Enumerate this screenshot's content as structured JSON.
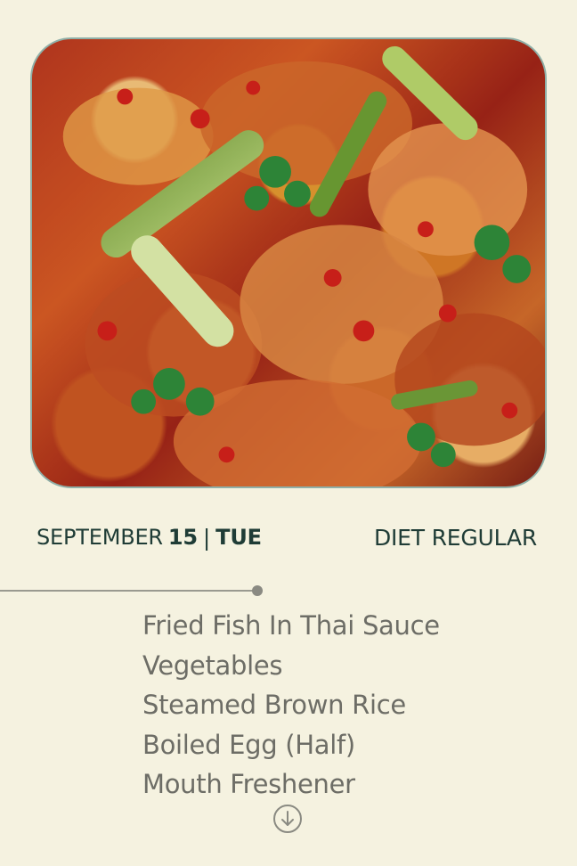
{
  "meal": {
    "image_icon": "food-image",
    "month": "SEPTEMBER",
    "day": "15",
    "separator": "|",
    "weekday": "TUE",
    "diet": "DIET REGULAR"
  },
  "menu": {
    "items": [
      "Fried Fish In Thai Sauce",
      "Vegetables",
      "Steamed Brown Rice",
      "Boiled Egg (Half)",
      "Mouth Freshener"
    ]
  },
  "controls": {
    "scroll_icon": "arrow-down-circle-icon"
  },
  "colors": {
    "background": "#f5f2e0",
    "heading": "#1f3c36",
    "menu_text": "#6d6d66",
    "image_border": "#8fb0a8"
  }
}
